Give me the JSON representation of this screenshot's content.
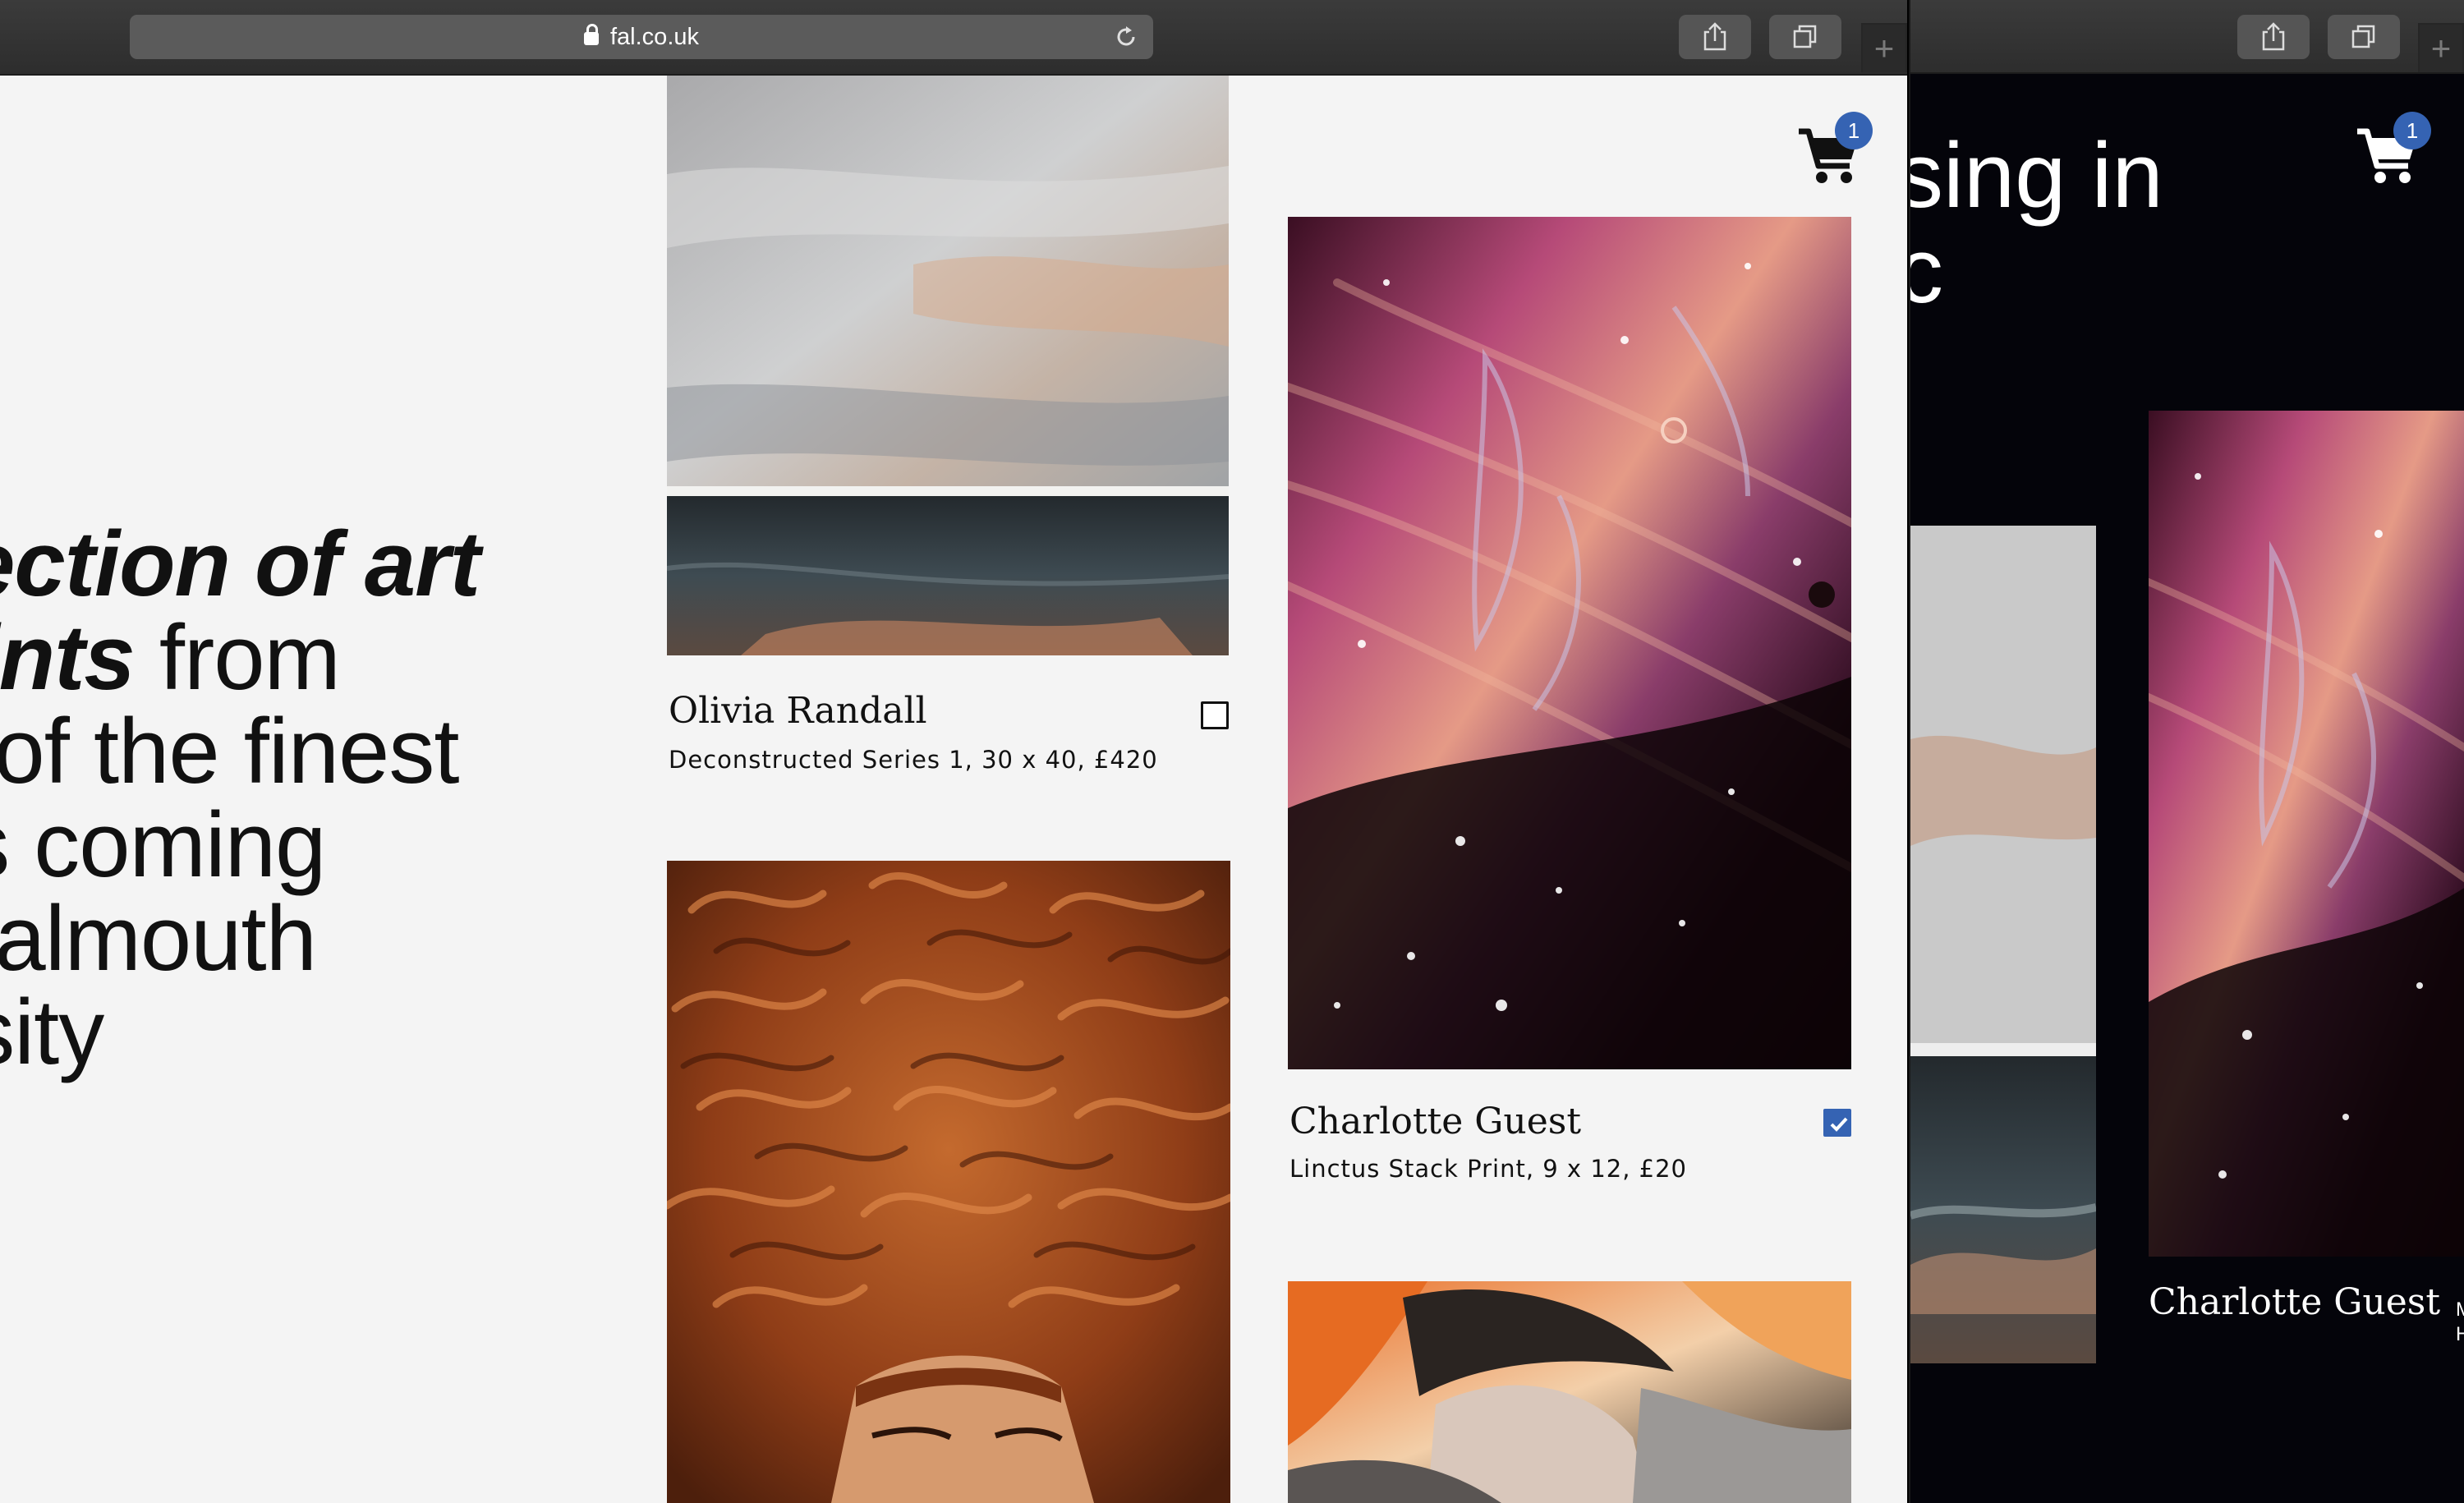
{
  "browser": {
    "url": "fal.co.uk",
    "icons": {
      "lock": "lock-icon",
      "reload": "reload-icon",
      "share": "share-icon",
      "tabs": "tabs-icon",
      "new_tab": "plus-icon"
    },
    "new_tab_label": "+"
  },
  "hero": {
    "lines": [
      {
        "bold": "lection of art",
        "rest": ""
      },
      {
        "bold": "rints",
        "rest": " from"
      },
      {
        "bold": "",
        "rest": "- of the finest"
      },
      {
        "bold": "",
        "rest": "ts coming"
      },
      {
        "bold": "",
        "rest": "Falmouth"
      },
      {
        "bold": "",
        "rest": "rsity"
      }
    ]
  },
  "cart": {
    "icon": "cart-icon",
    "count": "1"
  },
  "artworks": [
    {
      "artist": "Olivia Randall",
      "details": "Deconstructed Series 1, 30 x 40, £420",
      "selected": false
    },
    {
      "artist": "Charlotte Guest",
      "details": "Linctus Stack Print, 9 x 12, £20",
      "selected": true
    },
    {
      "artist": "",
      "details": "",
      "selected": false
    },
    {
      "artist": "",
      "details": "",
      "selected": false
    }
  ],
  "back_window": {
    "hero_lines": [
      "sing in",
      "c"
    ],
    "artist": "Charlotte Guest",
    "detail_fragment": [
      "M",
      "H"
    ],
    "cart_count": "1"
  },
  "colors": {
    "accent": "#3563b3",
    "page_bg": "#f4f4f4",
    "dark_bg": "#04040a",
    "text": "#111111"
  }
}
